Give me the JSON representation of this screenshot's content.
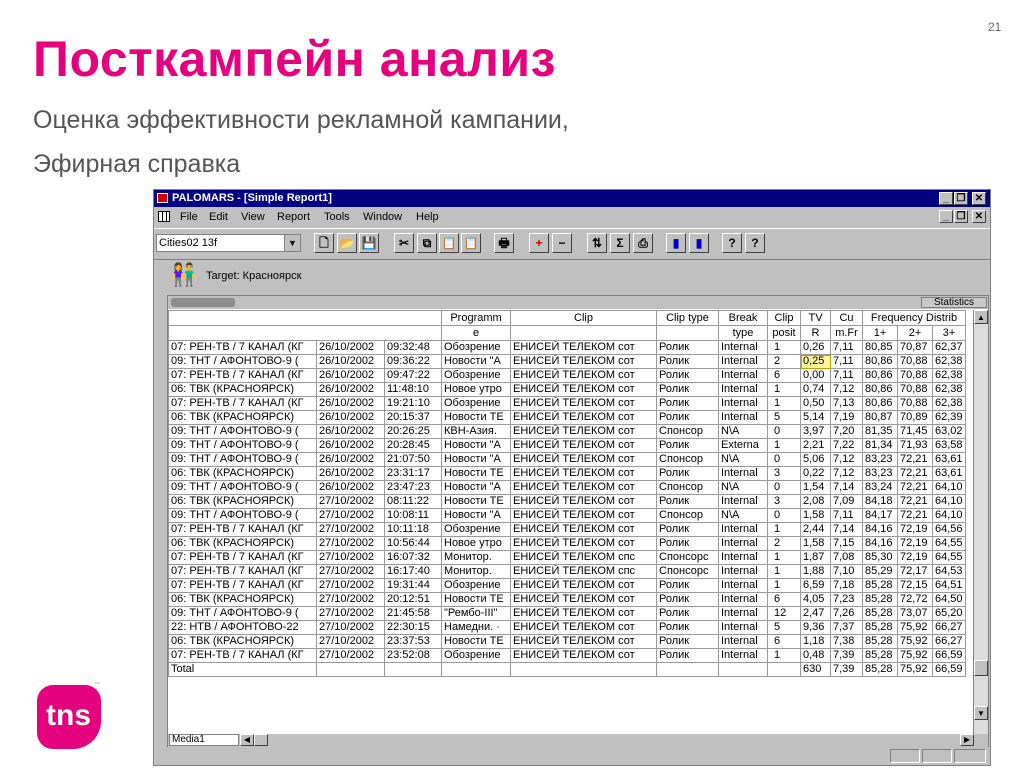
{
  "slide": {
    "number": "21",
    "title": "Посткампейн анализ",
    "subtitle": "Оценка эффективности рекламной кампании,",
    "subtitle2": "Эфирная справка",
    "logo_text": "tns",
    "logo_tm": "™"
  },
  "window": {
    "title": "PALOMARS - [Simple Report1]",
    "controls": {
      "minimize": "_",
      "restore": "❐",
      "close": "✕"
    },
    "menu": [
      "File",
      "Edit",
      "View",
      "Report",
      "Tools",
      "Window",
      "Help"
    ],
    "combo_value": "Cities02 13f",
    "target_label": "Target: Красноярск",
    "statistics_label": "Statistics",
    "sheet_tab": "Media1"
  },
  "toolbar": {
    "icons": [
      "new-document-icon",
      "open-folder-icon",
      "save-disk-icon",
      "cut-scissors-icon",
      "copy-icon",
      "paste-icon",
      "paste-special-icon",
      "print-icon",
      "add-plus-icon",
      "remove-minus-icon",
      "refresh-icon",
      "sum-sigma-icon",
      "report-icon",
      "bar-chart-icon",
      "bar-chart-alt-icon",
      "help-icon",
      "context-help-icon"
    ],
    "glyphs": [
      "🗋",
      "📂",
      "💾",
      "✂",
      "⧉",
      "📋",
      "📋",
      "🖶",
      "+",
      "−",
      "⇅",
      "Σ",
      "⎙",
      "▮",
      "▮",
      "?",
      "?"
    ]
  },
  "table": {
    "header_row1": [
      "",
      "Programm",
      "Clip",
      "Clip type",
      "Break",
      "Clip",
      "TV",
      "Cu",
      "Frequency Distrib",
      ""
    ],
    "header_row2": [
      "",
      "e",
      "",
      "",
      "type",
      "posit",
      "R",
      "m.Fr",
      "1+",
      "2+",
      "3+"
    ],
    "rows": [
      [
        "07: РЕН-ТВ / 7 КАНАЛ (КГ",
        "26/10/2002",
        "09:32:48",
        "Обозрение",
        "ЕНИСЕЙ ТЕЛЕКОМ сот",
        "Ролик",
        "Internal",
        "1",
        "0,26",
        "7,11",
        "80,85",
        "70,87",
        "62,37"
      ],
      [
        "09: ТНТ / АФОНТОВО-9 (",
        "26/10/2002",
        "09:36:22",
        "Новости \"А",
        "ЕНИСЕЙ ТЕЛЕКОМ сот",
        "Ролик",
        "Internal",
        "2",
        "0,25",
        "7,11",
        "80,86",
        "70,88",
        "62,38"
      ],
      [
        "07: РЕН-ТВ / 7 КАНАЛ (КГ",
        "26/10/2002",
        "09:47:22",
        "Обозрение",
        "ЕНИСЕЙ ТЕЛЕКОМ сот",
        "Ролик",
        "Internal",
        "6",
        "0,00",
        "7,11",
        "80,86",
        "70,88",
        "62,38"
      ],
      [
        "06: ТВК (КРАСНОЯРСК)",
        "26/10/2002",
        "11:48:10",
        "Новое утро",
        "ЕНИСЕЙ ТЕЛЕКОМ сот",
        "Ролик",
        "Internal",
        "1",
        "0,74",
        "7,12",
        "80,86",
        "70,88",
        "62,38"
      ],
      [
        "07: РЕН-ТВ / 7 КАНАЛ (КГ",
        "26/10/2002",
        "19:21:10",
        "Обозрение",
        "ЕНИСЕЙ ТЕЛЕКОМ сот",
        "Ролик",
        "Internal",
        "1",
        "0,50",
        "7,13",
        "80,86",
        "70,88",
        "62,38"
      ],
      [
        "06: ТВК (КРАСНОЯРСК)",
        "26/10/2002",
        "20:15:37",
        "Новости ТЕ",
        "ЕНИСЕЙ ТЕЛЕКОМ сот",
        "Ролик",
        "Internal",
        "5",
        "5,14",
        "7,19",
        "80,87",
        "70,89",
        "62,39"
      ],
      [
        "09: ТНТ / АФОНТОВО-9 (",
        "26/10/2002",
        "20:26:25",
        "КВН-Азия.",
        "ЕНИСЕЙ ТЕЛЕКОМ сот",
        "Спонсор",
        "N\\A",
        "0",
        "3,97",
        "7,20",
        "81,35",
        "71,45",
        "63,02"
      ],
      [
        "09: ТНТ / АФОНТОВО-9 (",
        "26/10/2002",
        "20:28:45",
        "Новости \"А",
        "ЕНИСЕЙ ТЕЛЕКОМ сот",
        "Ролик",
        "Externa",
        "1",
        "2,21",
        "7,22",
        "81,34",
        "71,93",
        "63,58"
      ],
      [
        "09: ТНТ / АФОНТОВО-9 (",
        "26/10/2002",
        "21:07:50",
        "Новости \"А",
        "ЕНИСЕЙ ТЕЛЕКОМ сот",
        "Спонсор",
        "N\\A",
        "0",
        "5,06",
        "7,12",
        "83,23",
        "72,21",
        "63,61"
      ],
      [
        "06: ТВК (КРАСНОЯРСК)",
        "26/10/2002",
        "23:31:17",
        "Новости ТЕ",
        "ЕНИСЕЙ ТЕЛЕКОМ сот",
        "Ролик",
        "Internal",
        "3",
        "0,22",
        "7,12",
        "83,23",
        "72,21",
        "63,61"
      ],
      [
        "09: ТНТ / АФОНТОВО-9 (",
        "26/10/2002",
        "23:47:23",
        "Новости \"А",
        "ЕНИСЕЙ ТЕЛЕКОМ сот",
        "Спонсор",
        "N\\A",
        "0",
        "1,54",
        "7,14",
        "83,24",
        "72,21",
        "64,10"
      ],
      [
        "06: ТВК (КРАСНОЯРСК)",
        "27/10/2002",
        "08:11:22",
        "Новости ТЕ",
        "ЕНИСЕЙ ТЕЛЕКОМ сот",
        "Ролик",
        "Internal",
        "3",
        "2,08",
        "7,09",
        "84,18",
        "72,21",
        "64,10"
      ],
      [
        "09: ТНТ / АФОНТОВО-9 (",
        "27/10/2002",
        "10:08:11",
        "Новости \"А",
        "ЕНИСЕЙ ТЕЛЕКОМ сот",
        "Спонсор",
        "N\\A",
        "0",
        "1,58",
        "7,11",
        "84,17",
        "72,21",
        "64,10"
      ],
      [
        "07: РЕН-ТВ / 7 КАНАЛ (КГ",
        "27/10/2002",
        "10:11:18",
        "Обозрение",
        "ЕНИСЕЙ ТЕЛЕКОМ сот",
        "Ролик",
        "Internal",
        "1",
        "2,44",
        "7,14",
        "84,16",
        "72,19",
        "64,56"
      ],
      [
        "06: ТВК (КРАСНОЯРСК)",
        "27/10/2002",
        "10:56:44",
        "Новое утро",
        "ЕНИСЕЙ ТЕЛЕКОМ сот",
        "Ролик",
        "Internal",
        "2",
        "1,58",
        "7,15",
        "84,16",
        "72,19",
        "64,55"
      ],
      [
        "07: РЕН-ТВ / 7 КАНАЛ (КГ",
        "27/10/2002",
        "16:07:32",
        "Монитор.",
        "ЕНИСЕЙ ТЕЛЕКОМ спс",
        "Спонсорс",
        "Internal",
        "1",
        "1,87",
        "7,08",
        "85,30",
        "72,19",
        "64,55"
      ],
      [
        "07: РЕН-ТВ / 7 КАНАЛ (КГ",
        "27/10/2002",
        "16:17:40",
        "Монитор.",
        "ЕНИСЕЙ ТЕЛЕКОМ спс",
        "Спонсорс",
        "Internal",
        "1",
        "1,88",
        "7,10",
        "85,29",
        "72,17",
        "64,53"
      ],
      [
        "07: РЕН-ТВ / 7 КАНАЛ (КГ",
        "27/10/2002",
        "19:31:44",
        "Обозрение",
        "ЕНИСЕЙ ТЕЛЕКОМ сот",
        "Ролик",
        "Internal",
        "1",
        "6,59",
        "7,18",
        "85,28",
        "72,15",
        "64,51"
      ],
      [
        "06: ТВК (КРАСНОЯРСК)",
        "27/10/2002",
        "20:12:51",
        "Новости ТЕ",
        "ЕНИСЕЙ ТЕЛЕКОМ сот",
        "Ролик",
        "Internal",
        "6",
        "4,05",
        "7,23",
        "85,28",
        "72,72",
        "64,50"
      ],
      [
        "09: ТНТ / АФОНТОВО-9 (",
        "27/10/2002",
        "21:45:58",
        "\"Рембо-III\"",
        "ЕНИСЕЙ ТЕЛЕКОМ сот",
        "Ролик",
        "Internal",
        "12",
        "2,47",
        "7,26",
        "85,28",
        "73,07",
        "65,20"
      ],
      [
        "22: НТВ / АФОНТОВО-22",
        "27/10/2002",
        "22:30:15",
        "Намедни. ·",
        "ЕНИСЕЙ ТЕЛЕКОМ сот",
        "Ролик",
        "Internal",
        "5",
        "9,36",
        "7,37",
        "85,28",
        "75,92",
        "66,27"
      ],
      [
        "06: ТВК (КРАСНОЯРСК)",
        "27/10/2002",
        "23:37:53",
        "Новости ТЕ",
        "ЕНИСЕЙ ТЕЛЕКОМ сот",
        "Ролик",
        "Internal",
        "6",
        "1,18",
        "7,38",
        "85,28",
        "75,92",
        "66,27"
      ],
      [
        "07: РЕН-ТВ / 7 КАНАЛ (КГ",
        "27/10/2002",
        "23:52:08",
        "Обозрение",
        "ЕНИСЕЙ ТЕЛЕКОМ сот",
        "Ролик",
        "Internal",
        "1",
        "0,48",
        "7,39",
        "85,28",
        "75,92",
        "66,59"
      ]
    ],
    "total_row": [
      "Total",
      "",
      "",
      "",
      "",
      "",
      "",
      "",
      "630",
      "7,39",
      "85,28",
      "75,92",
      "66,59"
    ]
  }
}
